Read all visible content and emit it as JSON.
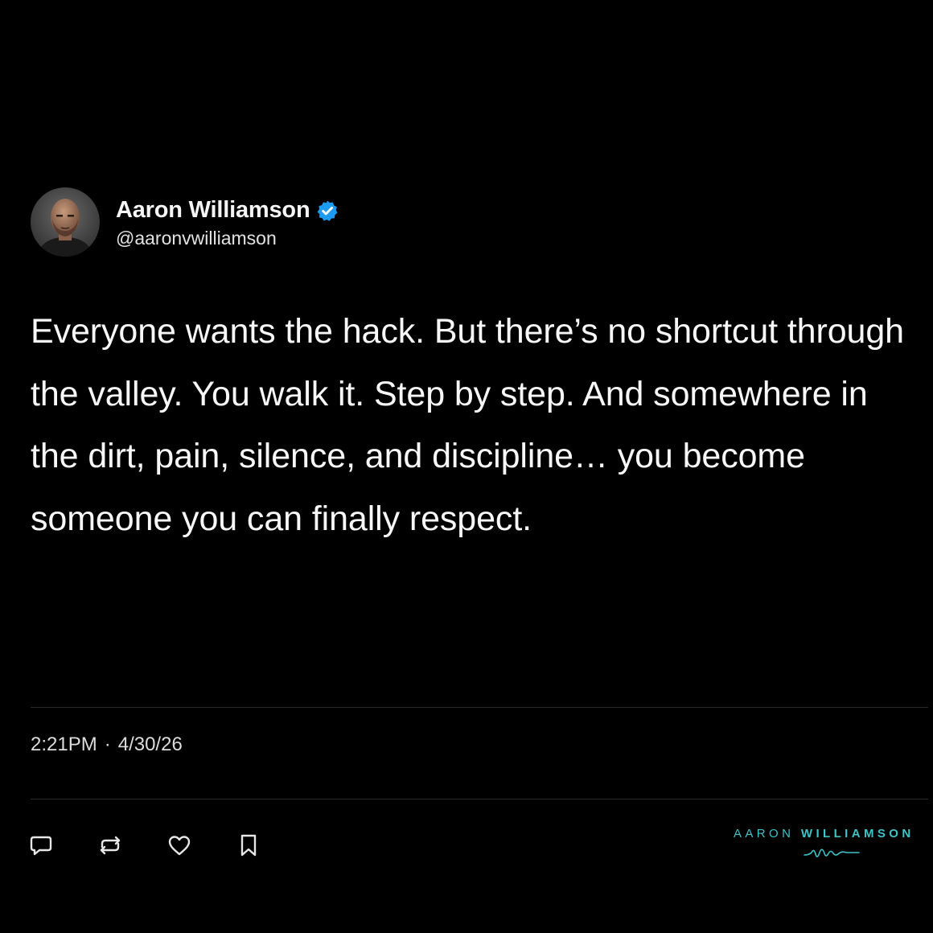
{
  "user": {
    "display_name": "Aaron Williamson",
    "handle": "@aaronvwilliamson",
    "verified": true,
    "avatar_icon": "person-portrait"
  },
  "tweet": {
    "text": "Everyone wants the hack. But there’s no shortcut through the valley. You walk it. Step by step. And somewhere in the dirt, pain, silence, and discipline… you become someone you can finally respect."
  },
  "meta": {
    "time": "2:21PM",
    "separator": "·",
    "date": "4/30/26"
  },
  "actions": [
    {
      "icon": "reply-icon"
    },
    {
      "icon": "retweet-icon"
    },
    {
      "icon": "like-icon"
    },
    {
      "icon": "bookmark-icon"
    }
  ],
  "brand": {
    "name_part1": "AARON",
    "name_part2": "WILLIAMSON",
    "mark_icon": "signature-wave"
  },
  "colors": {
    "background": "#000000",
    "text": "#f7f7f7",
    "verified_badge": "#1d9bf0",
    "brand_accent": "#3fc3c8",
    "divider": "#2b2b2b"
  }
}
